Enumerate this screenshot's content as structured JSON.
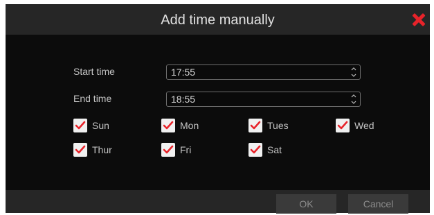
{
  "dialog": {
    "title": "Add time manually",
    "close_icon": "close-x-icon",
    "start_time_label": "Start time",
    "start_time_value": "17:55",
    "end_time_label": "End time",
    "end_time_value": "18:55",
    "days": [
      {
        "label": "Sun",
        "checked": true
      },
      {
        "label": "Mon",
        "checked": true
      },
      {
        "label": "Tues",
        "checked": true
      },
      {
        "label": "Wed",
        "checked": true
      },
      {
        "label": "Thur",
        "checked": true
      },
      {
        "label": "Fri",
        "checked": true
      },
      {
        "label": "Sat",
        "checked": true
      }
    ],
    "ok_label": "OK",
    "cancel_label": "Cancel"
  },
  "colors": {
    "accent": "#e8232a",
    "background": "#0c0c0c",
    "titlebar": "#262626"
  }
}
